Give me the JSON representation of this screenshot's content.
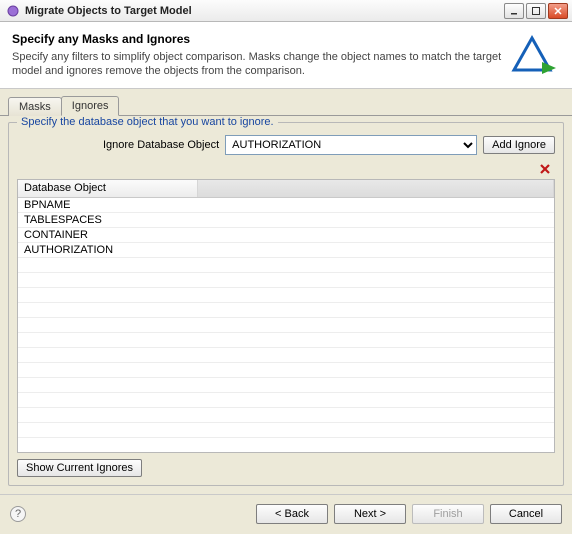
{
  "window": {
    "title": "Migrate Objects to Target Model"
  },
  "banner": {
    "heading": "Specify any Masks and Ignores",
    "description": "Specify any filters to simplify object comparison. Masks change the object names to match the target model and ignores remove the objects from the comparison."
  },
  "tabs": {
    "masks": "Masks",
    "ignores": "Ignores"
  },
  "group": {
    "legend": "Specify the database object that you want to ignore.",
    "label": "Ignore Database Object",
    "selected": "AUTHORIZATION",
    "add_button": "Add Ignore"
  },
  "table": {
    "header0": "Database Object",
    "header1": "",
    "rows": [
      {
        "c0": "BPNAME",
        "c1": ""
      },
      {
        "c0": "TABLESPACES",
        "c1": ""
      },
      {
        "c0": "CONTAINER",
        "c1": ""
      },
      {
        "c0": "AUTHORIZATION",
        "c1": ""
      }
    ]
  },
  "show_current": "Show Current Ignores",
  "footer": {
    "back": "< Back",
    "next": "Next >",
    "finish": "Finish",
    "cancel": "Cancel"
  }
}
